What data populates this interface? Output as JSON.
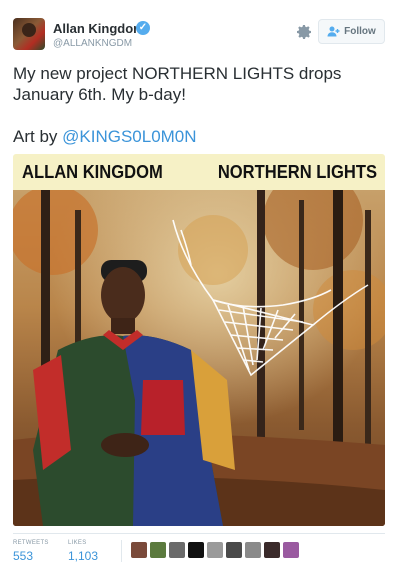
{
  "header": {
    "name": "Allan Kingdom",
    "handle": "@ALLANKNGDM",
    "follow_label": "Follow"
  },
  "tweet": {
    "text": "My new project NORTHERN LIGHTS drops January 6th. My b-day!",
    "art_prefix": "Art by ",
    "mention": "@KINGS0L0M0N"
  },
  "media": {
    "banner_left": "ALLAN KINGDOM",
    "banner_right": "NORTHERN LIGHTS"
  },
  "stats": {
    "retweets_label": "RETWEETS",
    "retweets_value": "553",
    "likes_label": "LIKES",
    "likes_value": "1,103"
  },
  "likers": [
    {
      "color": "#7a4a3a"
    },
    {
      "color": "#5b7a3e"
    },
    {
      "color": "#6a6a6a"
    },
    {
      "color": "#111111"
    },
    {
      "color": "#9a9a9a"
    },
    {
      "color": "#4a4a4a"
    },
    {
      "color": "#8a8a8a"
    },
    {
      "color": "#3a2a2a"
    },
    {
      "color": "#9a5aa0"
    }
  ],
  "icons": {
    "gear": "gear-icon",
    "verified": "verified-badge-icon",
    "follow": "add-user-icon"
  }
}
